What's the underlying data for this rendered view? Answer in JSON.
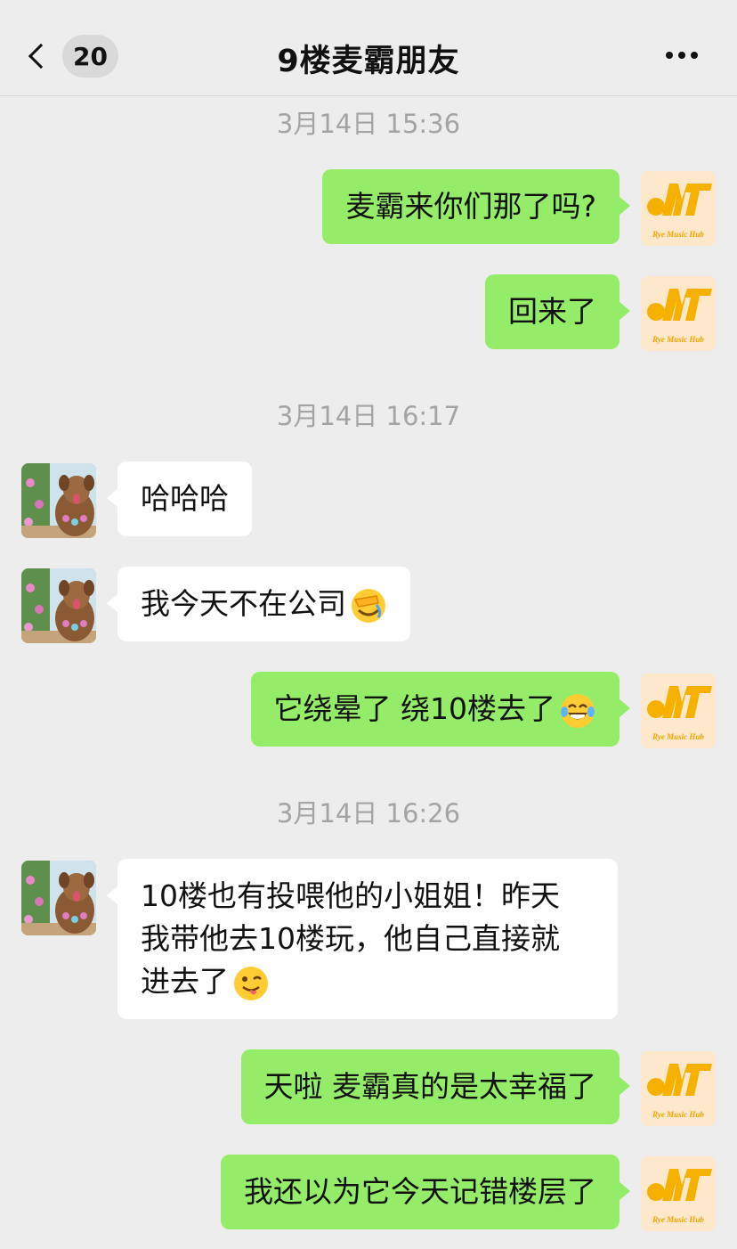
{
  "header": {
    "back_count": "20",
    "title": "9楼麦霸朋友"
  },
  "logo": {
    "text": "Rye Music Hub"
  },
  "messages": [
    {
      "type": "time",
      "text": "3月14日 15:36"
    },
    {
      "type": "msg",
      "from": "me",
      "text": "麦霸来你们那了吗?"
    },
    {
      "type": "msg",
      "from": "me",
      "text": "回来了"
    },
    {
      "type": "time",
      "text": "3月14日 16:17"
    },
    {
      "type": "msg",
      "from": "them",
      "text": "哈哈哈"
    },
    {
      "type": "msg",
      "from": "them",
      "text": "我今天不在公司",
      "emoji": "face-palm-emoji"
    },
    {
      "type": "msg",
      "from": "me",
      "text": "它绕晕了 绕10楼去了",
      "emoji": "tears-of-joy-emoji"
    },
    {
      "type": "time",
      "text": "3月14日 16:26"
    },
    {
      "type": "msg",
      "from": "them",
      "text_lines": [
        "10楼也有投喂他的小姐姐！昨天",
        "我带他去10楼玩，他自己直接就",
        "进去了"
      ],
      "emoji": "winking-tongue-emoji"
    },
    {
      "type": "msg",
      "from": "me",
      "text": "天啦 麦霸真的是太幸福了"
    },
    {
      "type": "msg",
      "from": "me",
      "text": "我还以为它今天记错楼层了"
    }
  ]
}
